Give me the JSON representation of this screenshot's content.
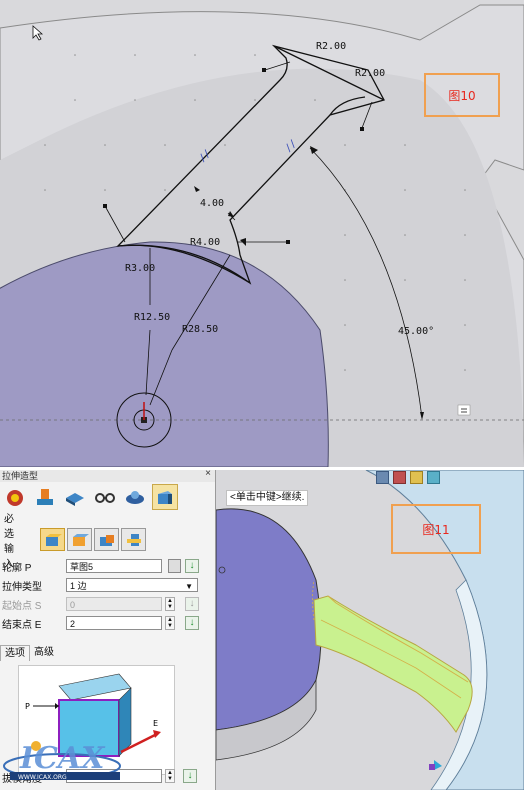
{
  "top_view": {
    "fig_label": "图10",
    "dims": {
      "r2_a": "R2.00",
      "r2_b": "R2.00",
      "d4": "4.00",
      "r4": "R4.00",
      "r3": "R3.00",
      "r12": "R12.50",
      "r28": "R28.50",
      "angle": "45.00°"
    },
    "parallel_mark_1": "//",
    "parallel_mark_2": "//",
    "minimize_icon": "minus-icon",
    "colors": {
      "background": "#d9d9dc",
      "disc": "#9e9ac4",
      "sketch": "#111111"
    }
  },
  "panel": {
    "title": "拉伸造型",
    "close_label": "×",
    "section_required": "必选输入",
    "profile": {
      "label": "轮廓 P",
      "value": "草图5"
    },
    "extrude_type": {
      "label": "拉伸类型",
      "value": "1 边",
      "options": [
        "1 边"
      ]
    },
    "start_point": {
      "label": "起始点 S",
      "value": "0"
    },
    "end_point": {
      "label": "结束点 E",
      "value": "2"
    },
    "tabs": [
      "选项",
      "高级"
    ],
    "preview_labels": {
      "p": "P",
      "e": "E"
    },
    "bottom_label": "拔模角度",
    "logo_text": "ICAX",
    "logo_url": "WWW.ICAX.ORG"
  },
  "viewport": {
    "hint": "<单击中键>继续.",
    "fig_label": "图11",
    "colors": {
      "solid_blue": "#7e7cc8",
      "extrude_green": "#c9f18f",
      "ring": "#c8dfee"
    }
  }
}
